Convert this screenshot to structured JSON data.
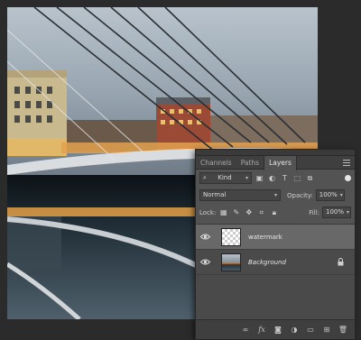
{
  "panel": {
    "tabs": [
      {
        "label": "Channels"
      },
      {
        "label": "Paths"
      },
      {
        "label": "Layers"
      }
    ],
    "filter": {
      "value": "Kind"
    },
    "blend_mode": {
      "value": "Normal"
    },
    "opacity": {
      "label": "Opacity:",
      "value": "100%"
    },
    "lock": {
      "label": "Lock:"
    },
    "fill": {
      "label": "Fill:",
      "value": "100%"
    },
    "layers": [
      {
        "name": "watermark",
        "selected": true,
        "thumbnail": "transparent-checker"
      },
      {
        "name": "Background",
        "selected": false,
        "thumbnail": "photo",
        "locked": true
      }
    ],
    "footer_icons": [
      "link-icon",
      "fx-icon",
      "mask-icon",
      "adjustment-icon",
      "folder-icon",
      "new-layer-icon",
      "trash-icon"
    ]
  },
  "colors": {
    "panel_bg": "#535353",
    "selected_layer": "#686868",
    "app_bg": "#2b2b2b"
  }
}
